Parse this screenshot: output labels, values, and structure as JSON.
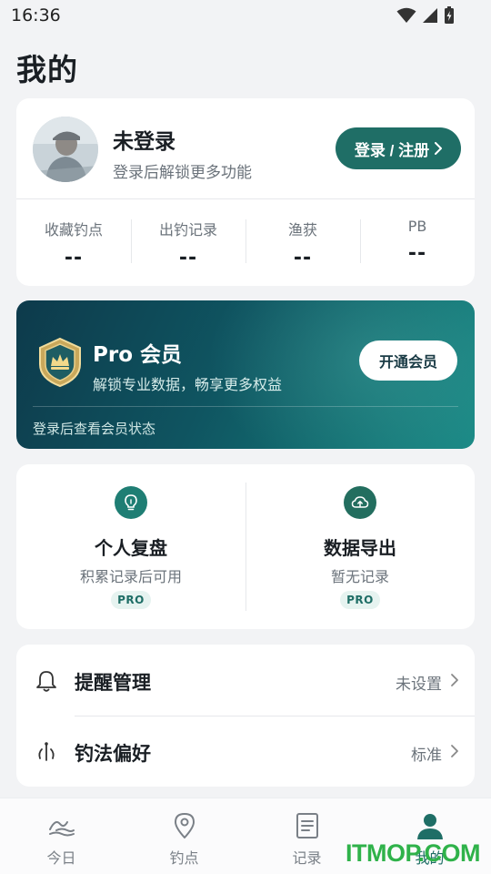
{
  "status_bar": {
    "time": "16:36"
  },
  "page": {
    "title": "我的"
  },
  "profile": {
    "name": "未登录",
    "subtitle": "登录后解锁更多功能",
    "login_button": "登录 / 注册",
    "stats": [
      {
        "label": "收藏钓点",
        "value": "--"
      },
      {
        "label": "出钓记录",
        "value": "--"
      },
      {
        "label": "渔获",
        "value": "--"
      },
      {
        "label": "PB",
        "value": "--"
      }
    ]
  },
  "pro": {
    "title": "Pro 会员",
    "subtitle": "解锁专业数据，畅享更多权益",
    "button": "开通会员",
    "status": "登录后查看会员状态"
  },
  "features": [
    {
      "title": "个人复盘",
      "subtitle": "积累记录后可用",
      "tag": "PRO",
      "icon": "lightbulb-icon"
    },
    {
      "title": "数据导出",
      "subtitle": "暂无记录",
      "tag": "PRO",
      "icon": "cloud-upload-icon"
    }
  ],
  "settings": [
    {
      "label": "提醒管理",
      "value": "未设置",
      "icon": "bell-icon"
    },
    {
      "label": "钓法偏好",
      "value": "标准",
      "icon": "fishing-rod-icon"
    }
  ],
  "nav": [
    {
      "label": "今日",
      "icon": "waves-icon"
    },
    {
      "label": "钓点",
      "icon": "location-pin-icon"
    },
    {
      "label": "记录",
      "icon": "document-icon"
    },
    {
      "label": "我的",
      "icon": "person-icon"
    }
  ],
  "watermark": "ITMOP.COM",
  "colors": {
    "accent": "#1f6e66",
    "pro_gradient_start": "#0d3a4b",
    "pro_gradient_end": "#1b8a86"
  }
}
